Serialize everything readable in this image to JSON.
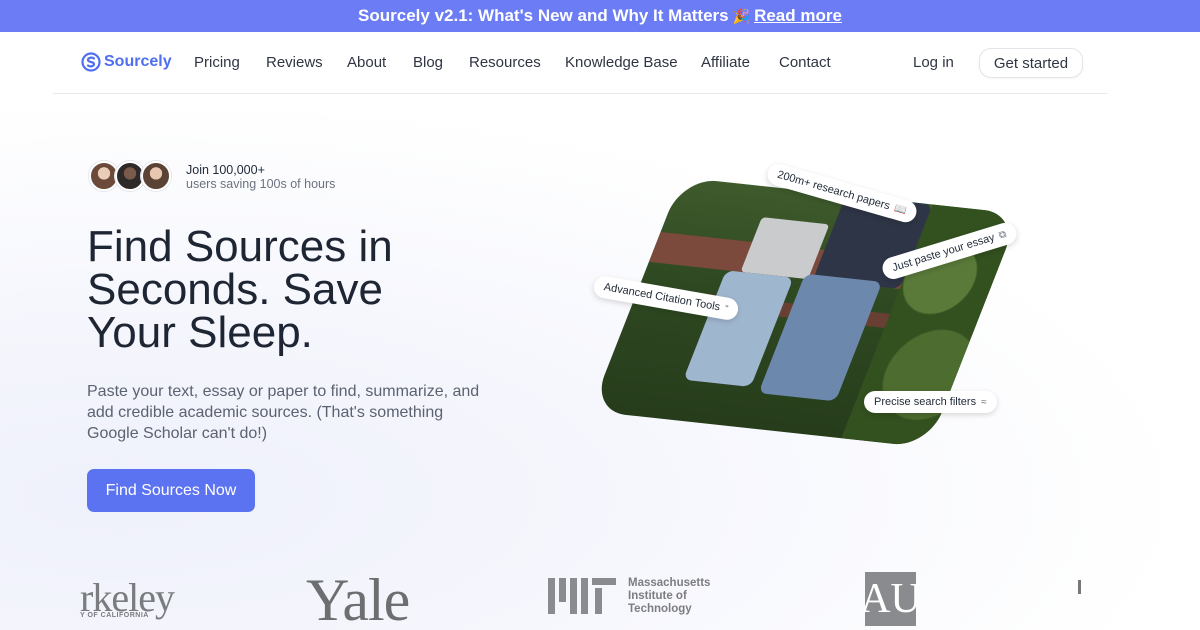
{
  "announcement": {
    "text": "Sourcely v2.1: What's New and Why It Matters",
    "emoji": "🎉",
    "link": "Read more"
  },
  "nav": {
    "logo": "Sourcely",
    "links": [
      "Pricing",
      "Reviews",
      "About",
      "Blog",
      "Resources",
      "Knowledge Base",
      "Affiliate",
      "Contact"
    ],
    "login": "Log in",
    "get_started": "Get started"
  },
  "hero": {
    "social_line1": "Join 100,000+",
    "social_line2": "users saving 100s of hours",
    "headline": "Find Sources in Seconds. Save Your Sleep.",
    "subtext": "Paste your text, essay or paper to find, summarize, and add credible academic sources. (That's something Google Scholar can't do!)",
    "cta": "Find Sources Now"
  },
  "feature_chips": [
    {
      "label": "200m+ research papers",
      "icon": "book-icon"
    },
    {
      "label": "Just paste your essay",
      "icon": "copy-icon"
    },
    {
      "label": "Advanced Citation Tools",
      "icon": "quote-icon"
    },
    {
      "label": "Precise search filters",
      "icon": "filter-icon"
    }
  ],
  "university_logos": {
    "berkeley": "rkeley",
    "berkeley_sub": "Y OF CALIFORNIA",
    "yale": "Yale",
    "mit_line1": "Massachusetts",
    "mit_line2": "Institute of",
    "mit_line3": "Technology",
    "au": "AU"
  },
  "colors": {
    "accent": "#5b73f0",
    "banner": "#6b7cf5",
    "logo": "#4f6ef0"
  }
}
